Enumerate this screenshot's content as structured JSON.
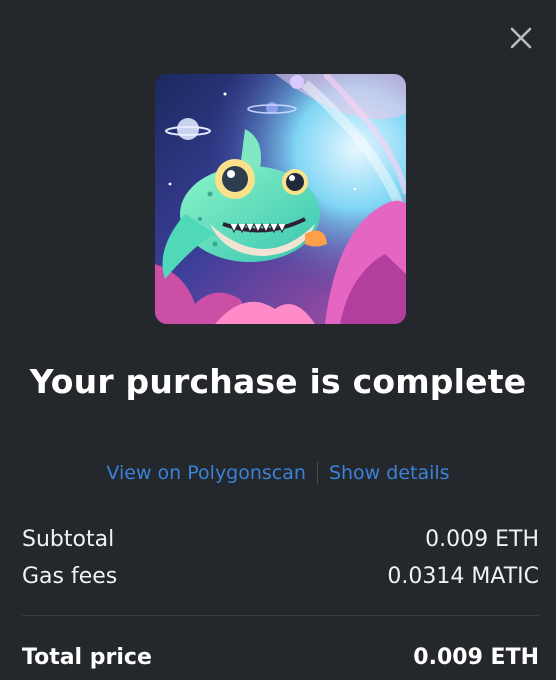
{
  "modal": {
    "title": "Your purchase is complete",
    "close_icon": "close-icon",
    "artwork": {
      "description_icon": "nft-artwork-image"
    },
    "links": {
      "view_on_explorer": "View on Polygonscan",
      "show_details": "Show details"
    },
    "summary": {
      "subtotal_label": "Subtotal",
      "subtotal_value": "0.009 ETH",
      "gas_label": "Gas fees",
      "gas_value": "0.0314 MATIC",
      "total_label": "Total price",
      "total_value": "0.009 ETH"
    }
  },
  "colors": {
    "background": "#24272b",
    "link": "#3b82d9",
    "text": "#ffffff",
    "divider": "#3a3d42"
  }
}
